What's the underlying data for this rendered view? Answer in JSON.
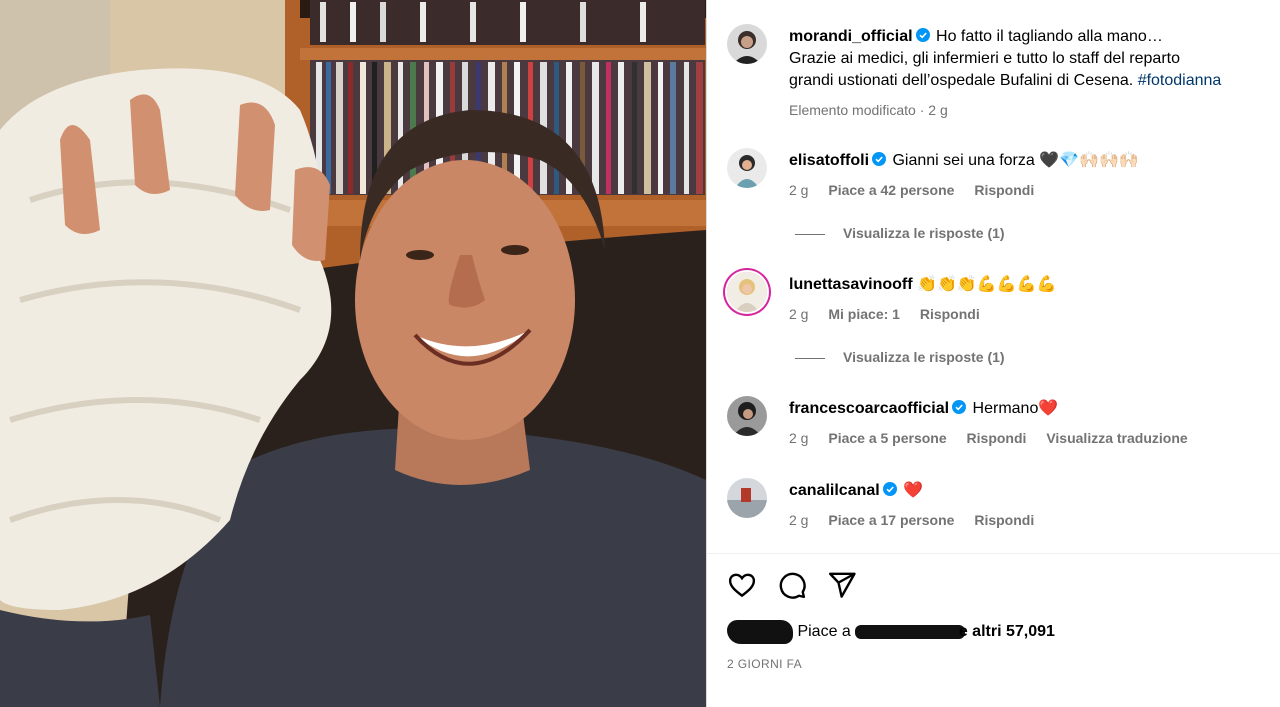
{
  "post": {
    "author": "morandi_official",
    "caption_l1": "Ho fatto il tagliando alla mano…",
    "caption_l2": "Grazie ai medici, gli infermieri e tutto lo staff del reparto",
    "caption_l3": "grandi ustionati dell’ospedale Bufalini di Cesena.",
    "hashtag": "#fotodianna",
    "edited": "Elemento modificato",
    "edited_time": "2 g"
  },
  "comments": [
    {
      "user": "elisatoffoli",
      "verified": true,
      "text": "Gianni sei una forza 🖤💎🙌🏻🙌🏻🙌🏻",
      "time": "2 g",
      "likes": "Piace a 42 persone",
      "reply": "Rispondi",
      "view_replies": "Visualizza le risposte (1)"
    },
    {
      "user": "lunettasavinooff",
      "verified": false,
      "text": "👏👏👏💪💪💪💪",
      "time": "2 g",
      "likes": "Mi piace: 1",
      "reply": "Rispondi",
      "view_replies": "Visualizza le risposte (1)"
    },
    {
      "user": "francescoarcaofficial",
      "verified": true,
      "text": "Hermano❤️",
      "time": "2 g",
      "likes": "Piace a 5 persone",
      "reply": "Rispondi",
      "translate": "Visualizza traduzione"
    },
    {
      "user": "canalilcanal",
      "verified": true,
      "text": "❤️",
      "time": "2 g",
      "likes": "Piace a 17 persone",
      "reply": "Rispondi"
    }
  ],
  "footer": {
    "likes_prefix": "Piace a",
    "likes_suffix": "e altri 57,091",
    "timestamp": "2 GIORNI FA"
  },
  "icons": {
    "like": "heart-icon",
    "comment": "comment-icon",
    "share": "share-icon",
    "verified": "verified-badge-icon"
  },
  "colors": {
    "verified": "#0095f6",
    "meta": "#737373",
    "hashtag": "#00376b",
    "story_ring": "#d6249f"
  }
}
